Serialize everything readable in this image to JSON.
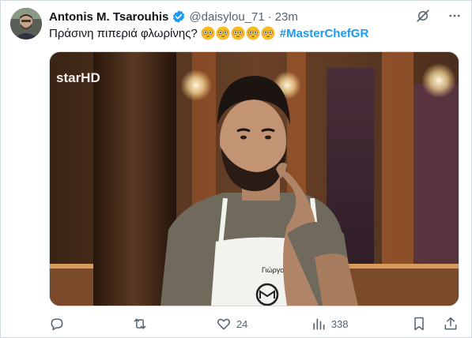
{
  "tweet": {
    "author_name": "Antonis M. Tsarouhis",
    "handle": "@daisylou_71",
    "separator": "·",
    "time": "23m",
    "text": "Πράσινη πιπεριά φλωρίνης?",
    "emojis": [
      "flushed-face-emoji",
      "flushed-face-emoji",
      "flushed-face-emoji",
      "flushed-face-emoji",
      "flushed-face-emoji"
    ],
    "hashtag": "#MasterChefGR"
  },
  "media": {
    "channel_logo": "starHD",
    "apron_name": "Γιώργος"
  },
  "actions": {
    "replies": "",
    "retweets": "",
    "likes": "24",
    "views": "338"
  },
  "icons": {
    "grok": "grok-icon",
    "more": "more-icon",
    "reply": "reply-icon",
    "retweet": "retweet-icon",
    "like": "heart-icon",
    "views": "views-icon",
    "bookmark": "bookmark-icon",
    "share": "share-icon"
  },
  "colors": {
    "accent": "#1d9bf0",
    "text": "#0f1419",
    "muted": "#536471",
    "border": "#cfd9de"
  }
}
